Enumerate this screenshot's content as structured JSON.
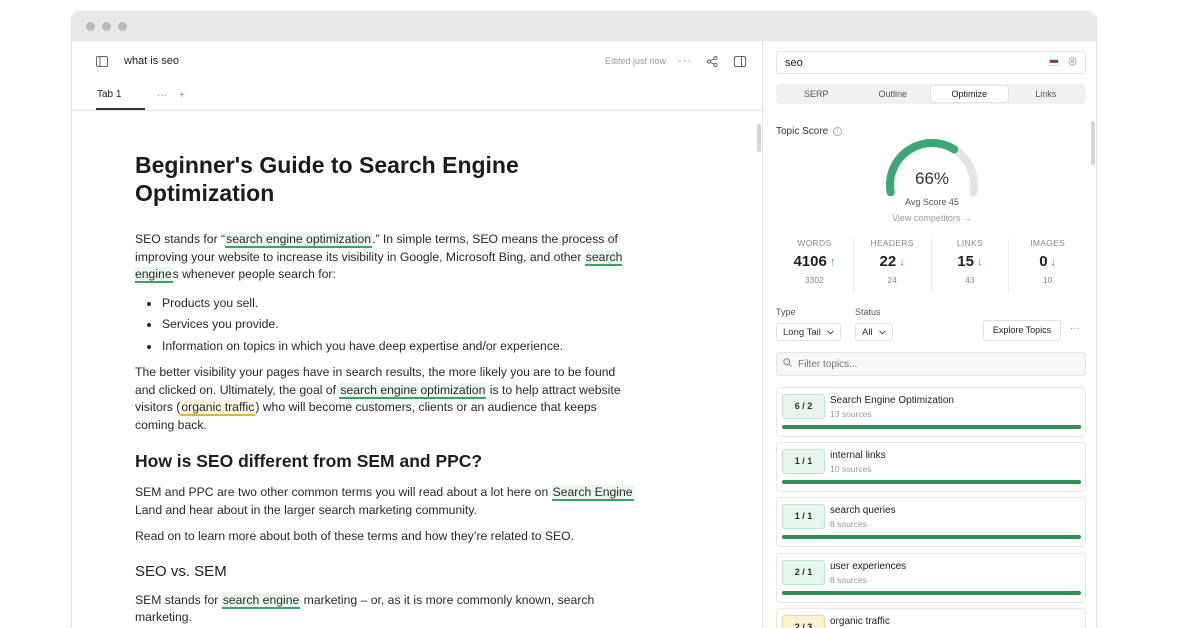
{
  "window": {
    "title_dots": 3
  },
  "editor": {
    "doc_title": "what is seo",
    "edited_status": "Edited just now",
    "tabs": [
      {
        "label": "Tab 1"
      }
    ],
    "tab_more": "···",
    "tab_add": "+",
    "heading": "Beginner's Guide to Search Engine Optimization",
    "para1": {
      "t1": "SEO stands for “",
      "kw1": "search engine optimization",
      "t2": ".” In simple terms, SEO means the process of improving your website to increase its visibility in Google, Microsoft Bing, and other ",
      "kw2": "search engine",
      "t3": "s whenever people search for:"
    },
    "bullets": [
      "Products you sell.",
      "Services you provide.",
      "Information on topics in which you have deep expertise and/or experience."
    ],
    "para2": {
      "t1": "The better visibility your pages have in search results, the more likely you are to be found and clicked on. Ultimately, the goal of ",
      "kw1": "search engine optimization",
      "t2": " is to help attract website visitors (",
      "kw2": "organic traffic",
      "t3": ") who will become customers, clients or an audience that keeps coming back."
    },
    "h2": "How is SEO different from SEM and PPC?",
    "para3": {
      "t1": "SEM and PPC are two other common terms you will read about a lot here on ",
      "kw1": "Search Engine",
      "t2": " Land and hear about in the larger search marketing community."
    },
    "para4": "Read on to learn more about both of these terms and how they’re related to SEO.",
    "h3": "SEO vs. SEM",
    "para5": {
      "t1": "SEM stands for ",
      "kw1": "search engine",
      "t2": " marketing – or, as it is more commonly known, search marketing."
    }
  },
  "panel": {
    "query": "seo",
    "tabs": [
      "SERP",
      "Outline",
      "Optimize",
      "Links"
    ],
    "active_tab": "Optimize",
    "topic_score_label": "Topic Score",
    "score_text": "66%",
    "score_value": 0.66,
    "avg_score": "Avg Score 45",
    "view_competitors": "View competitors →",
    "stats": [
      {
        "label": "WORDS",
        "value": "4106",
        "trend": "up",
        "sub": "3302"
      },
      {
        "label": "HEADERS",
        "value": "22",
        "trend": "down",
        "sub": "24"
      },
      {
        "label": "LINKS",
        "value": "15",
        "trend": "down",
        "sub": "43"
      },
      {
        "label": "IMAGES",
        "value": "0",
        "trend": "down",
        "sub": "10"
      }
    ],
    "type_label": "Type",
    "status_label": "Status",
    "type_value": "Long Tail",
    "status_value": "All",
    "explore_label": "Explore Topics",
    "filter_placeholder": "Filter topics...",
    "topics": [
      {
        "badge": "6 / 2",
        "name": "Search Engine Optimization",
        "sources": "13 sources",
        "color": "green"
      },
      {
        "badge": "1 / 1",
        "name": "internal links",
        "sources": "10 sources",
        "color": "green"
      },
      {
        "badge": "1 / 1",
        "name": "search queries",
        "sources": "8 sources",
        "color": "green"
      },
      {
        "badge": "2 / 1",
        "name": "user experiences",
        "sources": "8 sources",
        "color": "green"
      },
      {
        "badge": "2 / 3",
        "name": "organic traffic",
        "sources": "",
        "color": "yellow"
      }
    ],
    "colors": {
      "accent_green": "#2f8f57",
      "gauge_green": "#3aa876",
      "gauge_track": "#e4e4e4",
      "up": "#2ea36a",
      "down": "#e05151"
    }
  }
}
